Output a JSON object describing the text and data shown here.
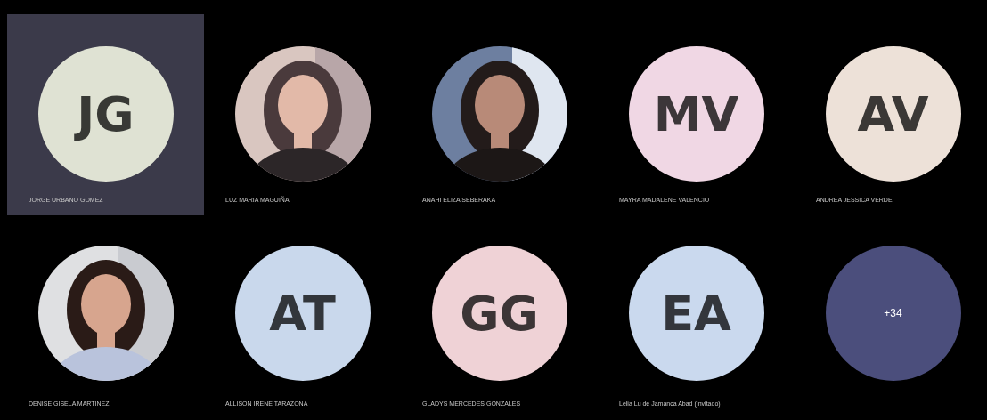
{
  "tiles": [
    {
      "kind": "initials",
      "initials": "JG",
      "name": "JORGE URBANO GOMEZ",
      "color": "#dfe2d3",
      "selected": true
    },
    {
      "kind": "picture",
      "name": "LUZ MARIA MAGUIÑA",
      "selected": false
    },
    {
      "kind": "picture",
      "name": "ANAHI ELIZA SEBERAKA",
      "selected": false
    },
    {
      "kind": "initials",
      "initials": "MV",
      "name": "MAYRA MADALENE VALENCIO",
      "color": "#f0d7e4",
      "selected": false
    },
    {
      "kind": "initials",
      "initials": "AV",
      "name": "ANDREA JESSICA VERDE",
      "color": "#ede1d8",
      "selected": false
    },
    {
      "kind": "picture",
      "name": "DENISE GISELA MARTINEZ",
      "selected": false
    },
    {
      "kind": "initials",
      "initials": "AT",
      "name": "ALLISON IRENE TARAZONA",
      "color": "#c9d8ec",
      "selected": false
    },
    {
      "kind": "initials",
      "initials": "GG",
      "name": "GLADYS MERCEDES GONZALES",
      "color": "#efd2d6",
      "selected": false
    },
    {
      "kind": "initials",
      "initials": "EA",
      "name": "Lelia Lu de Jamanca Abad (Invitado)",
      "color": "#cad9ee",
      "selected": false
    },
    {
      "kind": "overflow",
      "count": "+34",
      "color": "#4b4e7c",
      "selected": false
    }
  ]
}
